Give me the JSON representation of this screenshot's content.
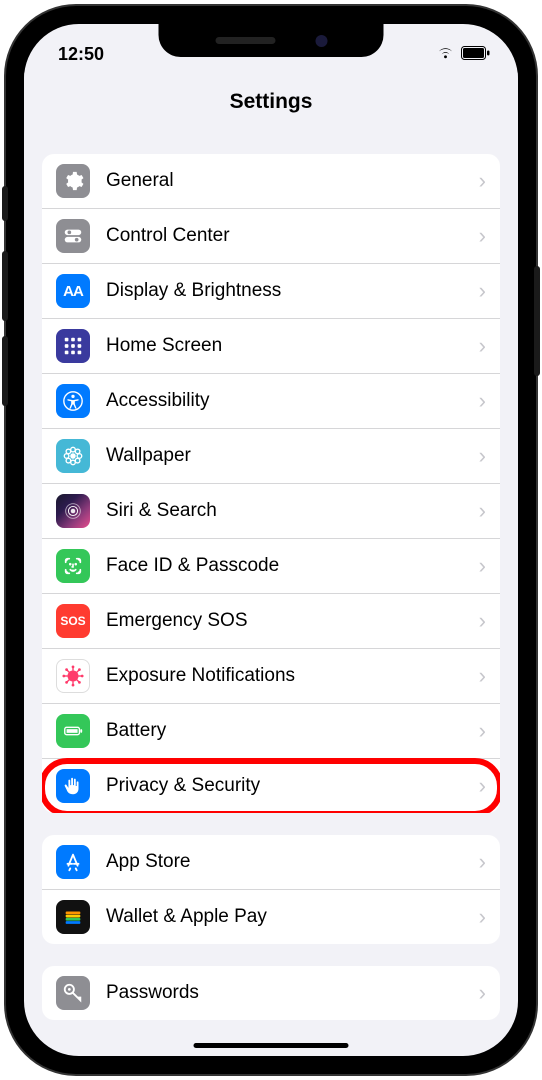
{
  "status": {
    "time": "12:50"
  },
  "header": {
    "title": "Settings"
  },
  "groups": [
    {
      "rows": [
        {
          "id": "general",
          "label": "General",
          "icon": "gear",
          "bg": "bg-gray",
          "highlighted": false
        },
        {
          "id": "control-center",
          "label": "Control Center",
          "icon": "toggles",
          "bg": "bg-gray",
          "highlighted": false
        },
        {
          "id": "display-brightness",
          "label": "Display & Brightness",
          "icon": "aa",
          "bg": "bg-blue",
          "highlighted": false
        },
        {
          "id": "home-screen",
          "label": "Home Screen",
          "icon": "grid",
          "bg": "bg-indigo",
          "highlighted": false
        },
        {
          "id": "accessibility",
          "label": "Accessibility",
          "icon": "person",
          "bg": "bg-blue",
          "highlighted": false
        },
        {
          "id": "wallpaper",
          "label": "Wallpaper",
          "icon": "flower",
          "bg": "bg-cyan",
          "highlighted": false
        },
        {
          "id": "siri-search",
          "label": "Siri & Search",
          "icon": "siri",
          "bg": "bg-siri",
          "highlighted": false
        },
        {
          "id": "face-id",
          "label": "Face ID & Passcode",
          "icon": "face",
          "bg": "bg-green",
          "highlighted": false
        },
        {
          "id": "emergency-sos",
          "label": "Emergency SOS",
          "icon": "sos",
          "bg": "bg-red",
          "highlighted": false
        },
        {
          "id": "exposure",
          "label": "Exposure Notifications",
          "icon": "covid",
          "bg": "bg-white",
          "highlighted": false
        },
        {
          "id": "battery",
          "label": "Battery",
          "icon": "battery",
          "bg": "bg-green",
          "highlighted": false
        },
        {
          "id": "privacy-security",
          "label": "Privacy & Security",
          "icon": "hand",
          "bg": "bg-blue",
          "highlighted": true
        }
      ]
    },
    {
      "rows": [
        {
          "id": "app-store",
          "label": "App Store",
          "icon": "appstore",
          "bg": "bg-blue",
          "highlighted": false
        },
        {
          "id": "wallet",
          "label": "Wallet & Apple Pay",
          "icon": "wallet",
          "bg": "bg-black",
          "highlighted": false
        }
      ]
    },
    {
      "rows": [
        {
          "id": "passwords",
          "label": "Passwords",
          "icon": "key",
          "bg": "bg-gray",
          "highlighted": false
        }
      ]
    }
  ]
}
